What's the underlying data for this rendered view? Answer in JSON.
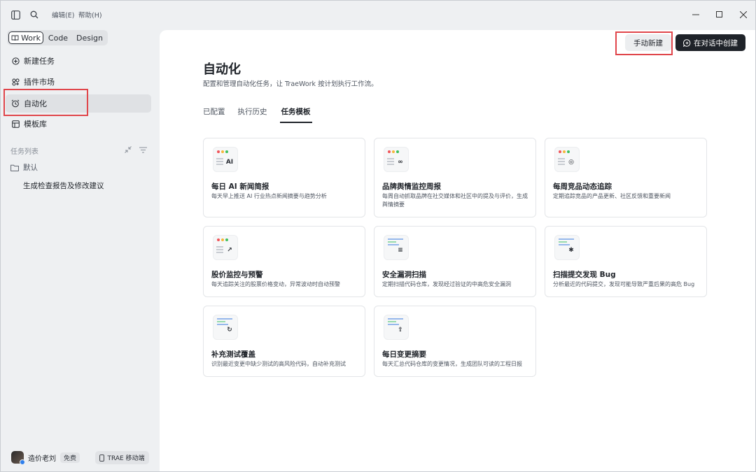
{
  "titlebar": {
    "menu_edit": "编辑(E)",
    "menu_help": "帮助(H)"
  },
  "sidebar": {
    "segments": [
      {
        "label": "Work",
        "active": true
      },
      {
        "label": "Code",
        "active": false
      },
      {
        "label": "Design",
        "active": false
      }
    ],
    "nav": [
      {
        "label": "新建任务",
        "icon": "plus-circle-icon"
      },
      {
        "label": "插件市场",
        "icon": "plugin-icon"
      },
      {
        "label": "自动化",
        "icon": "alarm-clock-icon",
        "active": true
      },
      {
        "label": "模板库",
        "icon": "template-icon"
      }
    ],
    "task_list_label": "任务列表",
    "folder_label": "默认",
    "task_item": "生成检查报告及修改建议",
    "user_name": "造价老刘",
    "user_badge": "免费",
    "mobile_label": "TRAE 移动端"
  },
  "main": {
    "manual_button": "手动新建",
    "chat_button": "在对话中创建",
    "title": "自动化",
    "subtitle": "配置和管理自动化任务，让 TraeWork 按计划执行工作流。",
    "tabs": [
      {
        "label": "已配置",
        "active": false
      },
      {
        "label": "执行历史",
        "active": false
      },
      {
        "label": "任务模板",
        "active": true
      }
    ],
    "cards": [
      {
        "title": "每日 AI 新闻简报",
        "desc": "每天早上推送 AI 行业热点新闻摘要与趋势分析",
        "icon": "ai-icon",
        "glyph": "AI",
        "style": "dots"
      },
      {
        "title": "品牌舆情监控周报",
        "desc": "每周自动抓取品牌在社交媒体和社区中的提及与评价，生成舆情摘要",
        "icon": "glasses-icon",
        "glyph": "∞",
        "style": "dots"
      },
      {
        "title": "每周竞品动态追踪",
        "desc": "定期追踪竞品的产品更新、社区反馈和重要新闻",
        "icon": "compass-icon",
        "glyph": "◎",
        "style": "dots"
      },
      {
        "title": "股价监控与预警",
        "desc": "每天追踪关注的股票价格变动，异常波动时自动预警",
        "icon": "trend-chart-icon",
        "glyph": "↗",
        "style": "dots"
      },
      {
        "title": "安全漏洞扫描",
        "desc": "定期扫描代码仓库，发现经过验证的中高危安全漏洞",
        "icon": "scan-search-icon",
        "glyph": "≡",
        "style": "bars"
      },
      {
        "title": "扫描提交发现 Bug",
        "desc": "分析最近的代码提交，发现可能导致严重后果的高危 Bug",
        "icon": "bug-icon",
        "glyph": "✱",
        "style": "bars"
      },
      {
        "title": "补充测试覆盖",
        "desc": "识别最近变更中缺少测试的高风险代码，自动补充测试",
        "icon": "search-refresh-icon",
        "glyph": "↻",
        "style": "bars"
      },
      {
        "title": "每日变更摘要",
        "desc": "每天汇总代码仓库的变更情况，生成团队可读的工程日报",
        "icon": "document-upload-icon",
        "glyph": "⇪",
        "style": "bars"
      }
    ]
  },
  "colors": {
    "accent_dark": "#1f2329",
    "highlight_red": "#e0464b",
    "dot_red": "#f0555a",
    "dot_yellow": "#f5b73b",
    "dot_green": "#3fbf5f",
    "bar_blue": "#7ea7e8",
    "bar_green": "#7fd39a"
  }
}
